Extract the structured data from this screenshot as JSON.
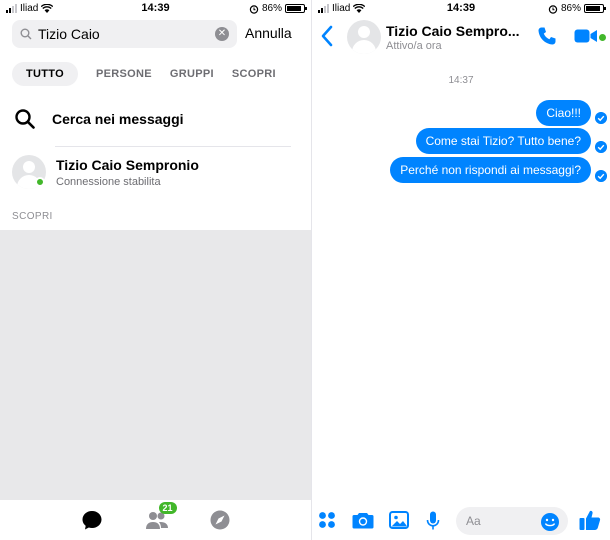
{
  "status_left": {
    "carrier": "Iliad",
    "time": "14:39",
    "battery": "86%"
  },
  "status_right": {
    "carrier": "Iliad",
    "time": "14:39",
    "battery": "86%"
  },
  "search": {
    "query": "Tizio Caio",
    "cancel_label": "Annulla"
  },
  "filter_tabs": [
    {
      "label": "TUTTO",
      "active": true
    },
    {
      "label": "PERSONE",
      "active": false
    },
    {
      "label": "GRUPPI",
      "active": false
    },
    {
      "label": "SCOPRI",
      "active": false
    }
  ],
  "search_messages_label": "Cerca nei messaggi",
  "contact": {
    "name": "Tizio Caio Sempronio",
    "status": "Connessione stabilita",
    "online": true
  },
  "section_label": "SCOPRI",
  "tabbar": {
    "people_badge": "21"
  },
  "chat": {
    "name": "Tizio Caio Sempro...",
    "status": "Attivo/a ora",
    "time": "14:37",
    "messages": [
      "Ciao!!!",
      "Come stai Tizio? Tutto bene?",
      "Perché non rispondi ai messaggi?"
    ]
  },
  "composer": {
    "placeholder": "Aa"
  },
  "colors": {
    "accent": "#0084ff",
    "online": "#42b72a",
    "discover_bg": "#e8e8ea"
  }
}
